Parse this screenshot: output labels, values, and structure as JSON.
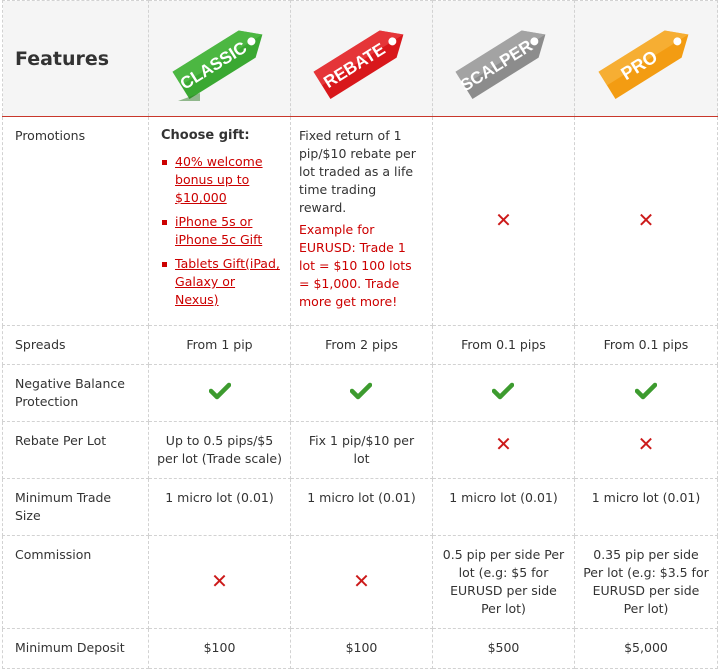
{
  "header": {
    "features_label": "Features",
    "plans": [
      {
        "name": "CLASSIC",
        "color": "#3aa832"
      },
      {
        "name": "REBATE",
        "color": "#d8171b"
      },
      {
        "name": "SCALPER",
        "color": "#8c8c8c"
      },
      {
        "name": "PRO",
        "color": "#f39c12"
      }
    ]
  },
  "rows": {
    "promotions": {
      "label": "Promotions",
      "classic": {
        "title": "Choose gift:",
        "gifts": [
          "40% welcome bonus up to $10,000",
          "iPhone 5s or iPhone 5c Gift",
          "Tablets Gift(iPad, Galaxy or Nexus)"
        ]
      },
      "rebate": {
        "text": "Fixed return of 1 pip/$10 rebate per lot traded as a life time trading reward.",
        "example": "Example for EURUSD: Trade 1 lot = $10 100 lots = $1,000. Trade more get more!"
      }
    },
    "spreads": {
      "label": "Spreads",
      "values": [
        "From 1 pip",
        "From 2 pips",
        "From 0.1 pips",
        "From 0.1 pips"
      ]
    },
    "negative_balance": {
      "label": "Negative Balance Protection"
    },
    "rebate_per_lot": {
      "label": "Rebate Per Lot",
      "values": [
        "Up to 0.5 pips/$5 per lot (Trade scale)",
        "Fix 1 pip/$10 per lot"
      ]
    },
    "min_trade": {
      "label": "Minimum Trade Size",
      "values": [
        "1 micro lot (0.01)",
        "1 micro lot (0.01)",
        "1 micro lot (0.01)",
        "1 micro lot (0.01)"
      ]
    },
    "commission": {
      "label": "Commission",
      "values": [
        "0.5 pip per side Per lot (e.g: $5 for EURUSD per side Per lot)",
        "0.35 pip per side Per lot (e.g: $3.5 for EURUSD per side Per lot)"
      ]
    },
    "min_deposit": {
      "label": "Minimum Deposit",
      "values": [
        "$100",
        "$100",
        "$500",
        "$5,000"
      ]
    }
  },
  "icons": {
    "check": "check-icon",
    "cross": "cross-icon",
    "check_color": "#3d9b2f",
    "cross_color": "#cc1a1a"
  }
}
